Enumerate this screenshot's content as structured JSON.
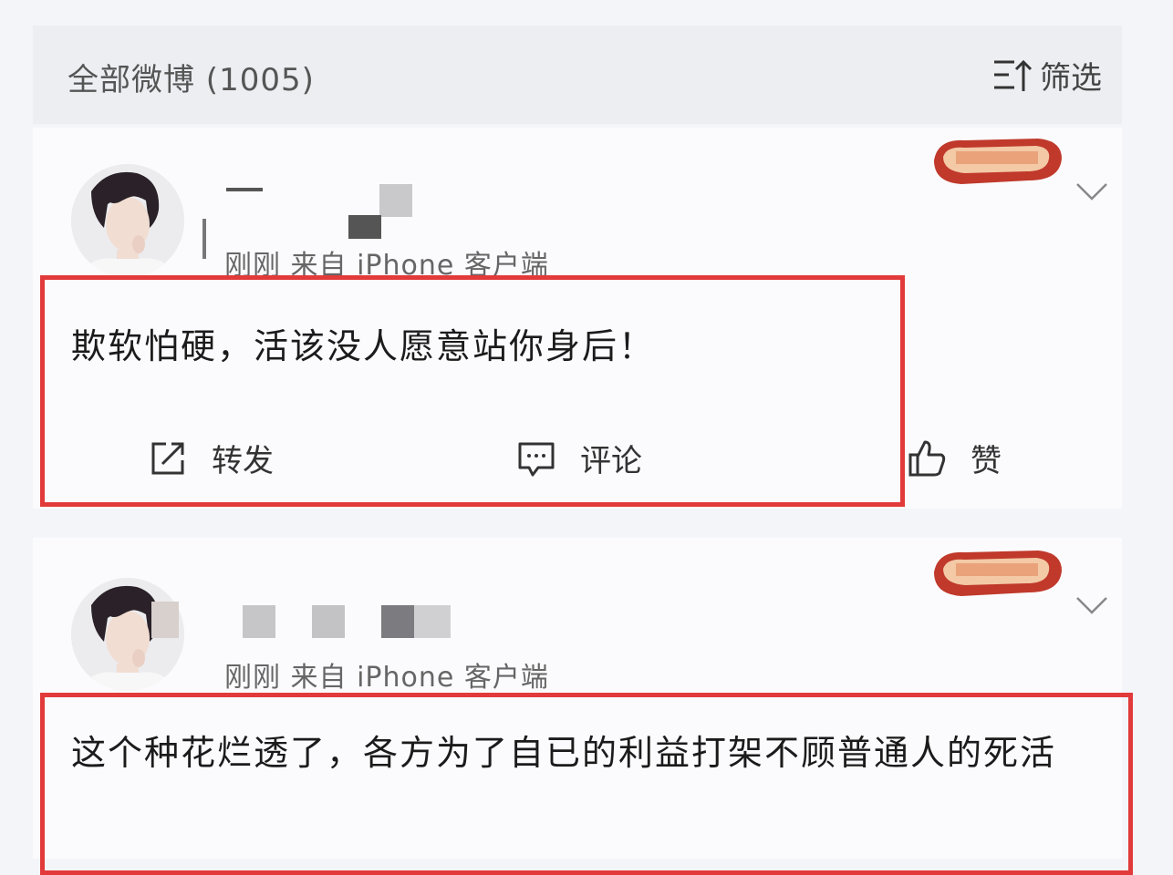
{
  "header": {
    "title": "全部微博 (1005)",
    "filter_label": "筛选"
  },
  "posts": [
    {
      "meta": "刚刚  来自 iPhone 客户端",
      "content": "欺软怕硬，活该没人愿意站你身后！",
      "actions": {
        "repost": "转发",
        "comment": "评论",
        "like": "赞"
      }
    },
    {
      "meta": "刚刚  来自 iPhone 客户端",
      "content": "这个种花烂透了，各方为了自已的利益打架不顾普通人的死活"
    }
  ],
  "colors": {
    "highlight_border": "#e23a3a",
    "header_bg": "#eceef2",
    "card_bg": "#fbfbfd",
    "meta_text": "#666666"
  },
  "icons": [
    "filter-icon",
    "avatar",
    "vip-badge-icon",
    "chevron-down-icon",
    "repost-icon",
    "comment-icon",
    "like-icon"
  ]
}
